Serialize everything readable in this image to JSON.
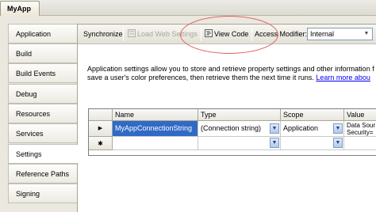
{
  "window": {
    "tab_title": "MyApp"
  },
  "nav": {
    "items": [
      {
        "label": "Application",
        "selected": false
      },
      {
        "label": "Build",
        "selected": false
      },
      {
        "label": "Build Events",
        "selected": false
      },
      {
        "label": "Debug",
        "selected": false
      },
      {
        "label": "Resources",
        "selected": false
      },
      {
        "label": "Services",
        "selected": false
      },
      {
        "label": "Settings",
        "selected": true
      },
      {
        "label": "Reference Paths",
        "selected": false
      },
      {
        "label": "Signing",
        "selected": false
      }
    ]
  },
  "toolbar": {
    "synchronize_label": "Synchronize",
    "load_web_settings_label": "Load Web Settings",
    "view_code_label": "View Code",
    "access_modifier_label": "Access Modifier:",
    "access_modifier_value": "Internal"
  },
  "description": {
    "line1": "Application settings allow you to store and retrieve property settings and other information f",
    "line2_text": "save a user's color preferences, then retrieve them the next time it runs.",
    "learn_more": "Learn more abou"
  },
  "grid": {
    "columns": [
      "Name",
      "Type",
      "Scope",
      "Value"
    ],
    "rows": [
      {
        "row_marker": "▶",
        "name": "MyAppConnectionString",
        "type": "(Connection string)",
        "scope": "Application",
        "value_line1": "Data Sour",
        "value_line2": "Security="
      },
      {
        "row_marker": "✱",
        "name": "",
        "type": "",
        "scope": "",
        "value_line1": "",
        "value_line2": ""
      }
    ]
  },
  "colors": {
    "selection": "#316ac5",
    "annotation_ellipse": "#e06060",
    "link": "#0000ee"
  }
}
